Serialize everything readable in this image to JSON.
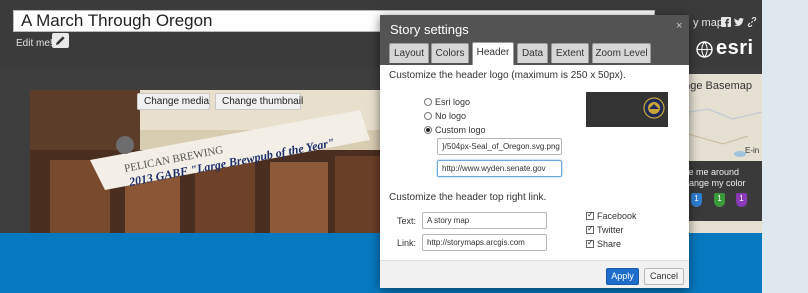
{
  "header": {
    "title_value": "A March Through Oregon",
    "edit_label": "Edit me!",
    "story_link_text": "y map",
    "brand": "esri"
  },
  "media": {
    "change_media_label": "Change media",
    "change_thumbnail_label": "Change thumbnail",
    "banner_line1": "PELICAN BREWING",
    "banner_line2": "2013 GABF \"Large Brewpub of the Year\""
  },
  "map": {
    "basemap_label": "ange Basemap",
    "place_label": "E-in",
    "popup_line1": "ve me around",
    "popup_line2": "hange my color",
    "pins": [
      "1",
      "1",
      "1"
    ],
    "pin_colors": [
      "#2f7fd0",
      "#3a9a3a",
      "#8a3ab8"
    ]
  },
  "dialog": {
    "title": "Story settings",
    "close_glyph": "×",
    "tabs": [
      "Layout",
      "Colors",
      "Header",
      "Data",
      "Extent",
      "Zoom Level"
    ],
    "active_tab": "Header",
    "logo_section_title": "Customize the header logo (maximum is 250 x 50px).",
    "logo_options": [
      "Esri logo",
      "No logo",
      "Custom logo"
    ],
    "selected_logo_option": "Custom logo",
    "logo_url_value": "}/504px-Seal_of_Oregon.svg.png",
    "logo_link_value": "http://www.wyden.senate.gov",
    "link_section_title": "Customize the header top right link.",
    "text_label": "Text:",
    "text_value": "A story map",
    "link_label": "Link:",
    "link_value": "http://storymaps.arcgis.com",
    "share_options": [
      "Facebook",
      "Twitter",
      "Share"
    ],
    "apply_label": "Apply",
    "cancel_label": "Cancel"
  },
  "colors": {
    "header_bg": "#3b3b3b",
    "accent_blue": "#0779c1",
    "apply_blue": "#1e6ec9",
    "dialog_header": "#535353"
  }
}
